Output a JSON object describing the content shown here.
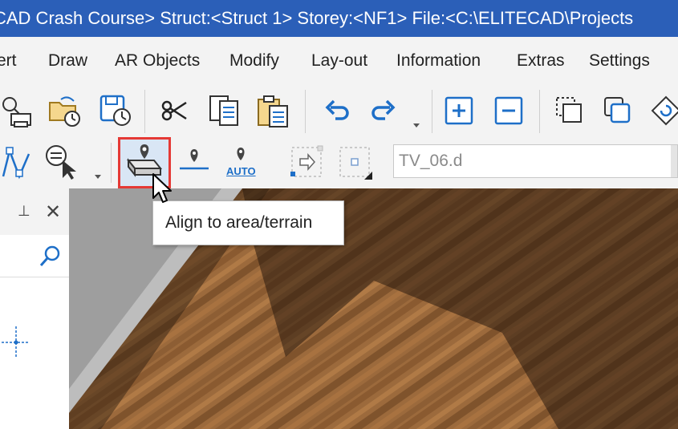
{
  "window": {
    "title": "CAD Crash Course> Struct:<Struct 1>  Storey:<NF1>  File:<C:\\ELITECAD\\Projects"
  },
  "menu": {
    "items": [
      "ert",
      "Draw",
      "AR Objects",
      "Modify",
      "Lay-out",
      "Information",
      "Extras",
      "Settings"
    ]
  },
  "toolbar2": {
    "auto_label": "AUTO",
    "combo_value": "TV_06.d"
  },
  "tooltip": {
    "text": "Align to area/terrain"
  },
  "colors": {
    "title_bar": "#2b5fb8",
    "toolbar_bg": "#f3f3f3",
    "icon_blue": "#1e6fc8",
    "highlight_border": "#e53935"
  },
  "icons": [
    "printer-icon",
    "open-folder-clock-icon",
    "save-clock-icon",
    "scissors-icon",
    "copy-icon",
    "paste-icon",
    "undo-icon",
    "redo-icon",
    "zoom-in-icon",
    "zoom-out-icon",
    "copy-frame-icon",
    "duplicate-icon",
    "rotate-icon",
    "polyline-icon",
    "select-filter-icon",
    "align-area-terrain-icon",
    "align-line-icon",
    "align-auto-icon",
    "move-arrow-icon",
    "center-point-icon",
    "pin-icon",
    "close-icon",
    "search-icon",
    "crosshair-icon",
    "cursor-icon"
  ]
}
